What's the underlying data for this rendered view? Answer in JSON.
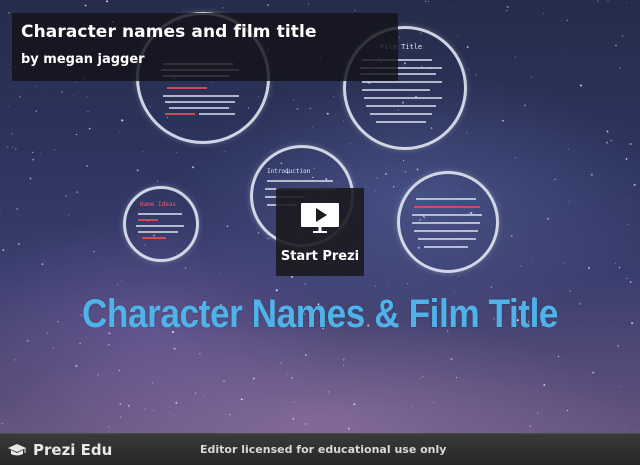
{
  "presentation": {
    "title": "Character names and film title",
    "author_line": "by megan  jagger"
  },
  "canvas": {
    "heading": "Character Names & Film Title",
    "circles": [
      {
        "id": "top-left",
        "label": ""
      },
      {
        "id": "top-right",
        "label": "Film Title"
      },
      {
        "id": "center",
        "label": "Introduction"
      },
      {
        "id": "left",
        "label": "Name Ideas"
      },
      {
        "id": "right",
        "label": ""
      }
    ]
  },
  "controls": {
    "start_label": "Start Prezi"
  },
  "footer": {
    "brand": "Prezi Edu",
    "license_text": "Editor licensed for educational use only"
  },
  "colors": {
    "heading": "#4fb3ea",
    "overlay": "#121218",
    "footer": "#2e2e2e"
  },
  "icons": {
    "play": "play-icon",
    "logo": "graduation-cap-icon"
  }
}
